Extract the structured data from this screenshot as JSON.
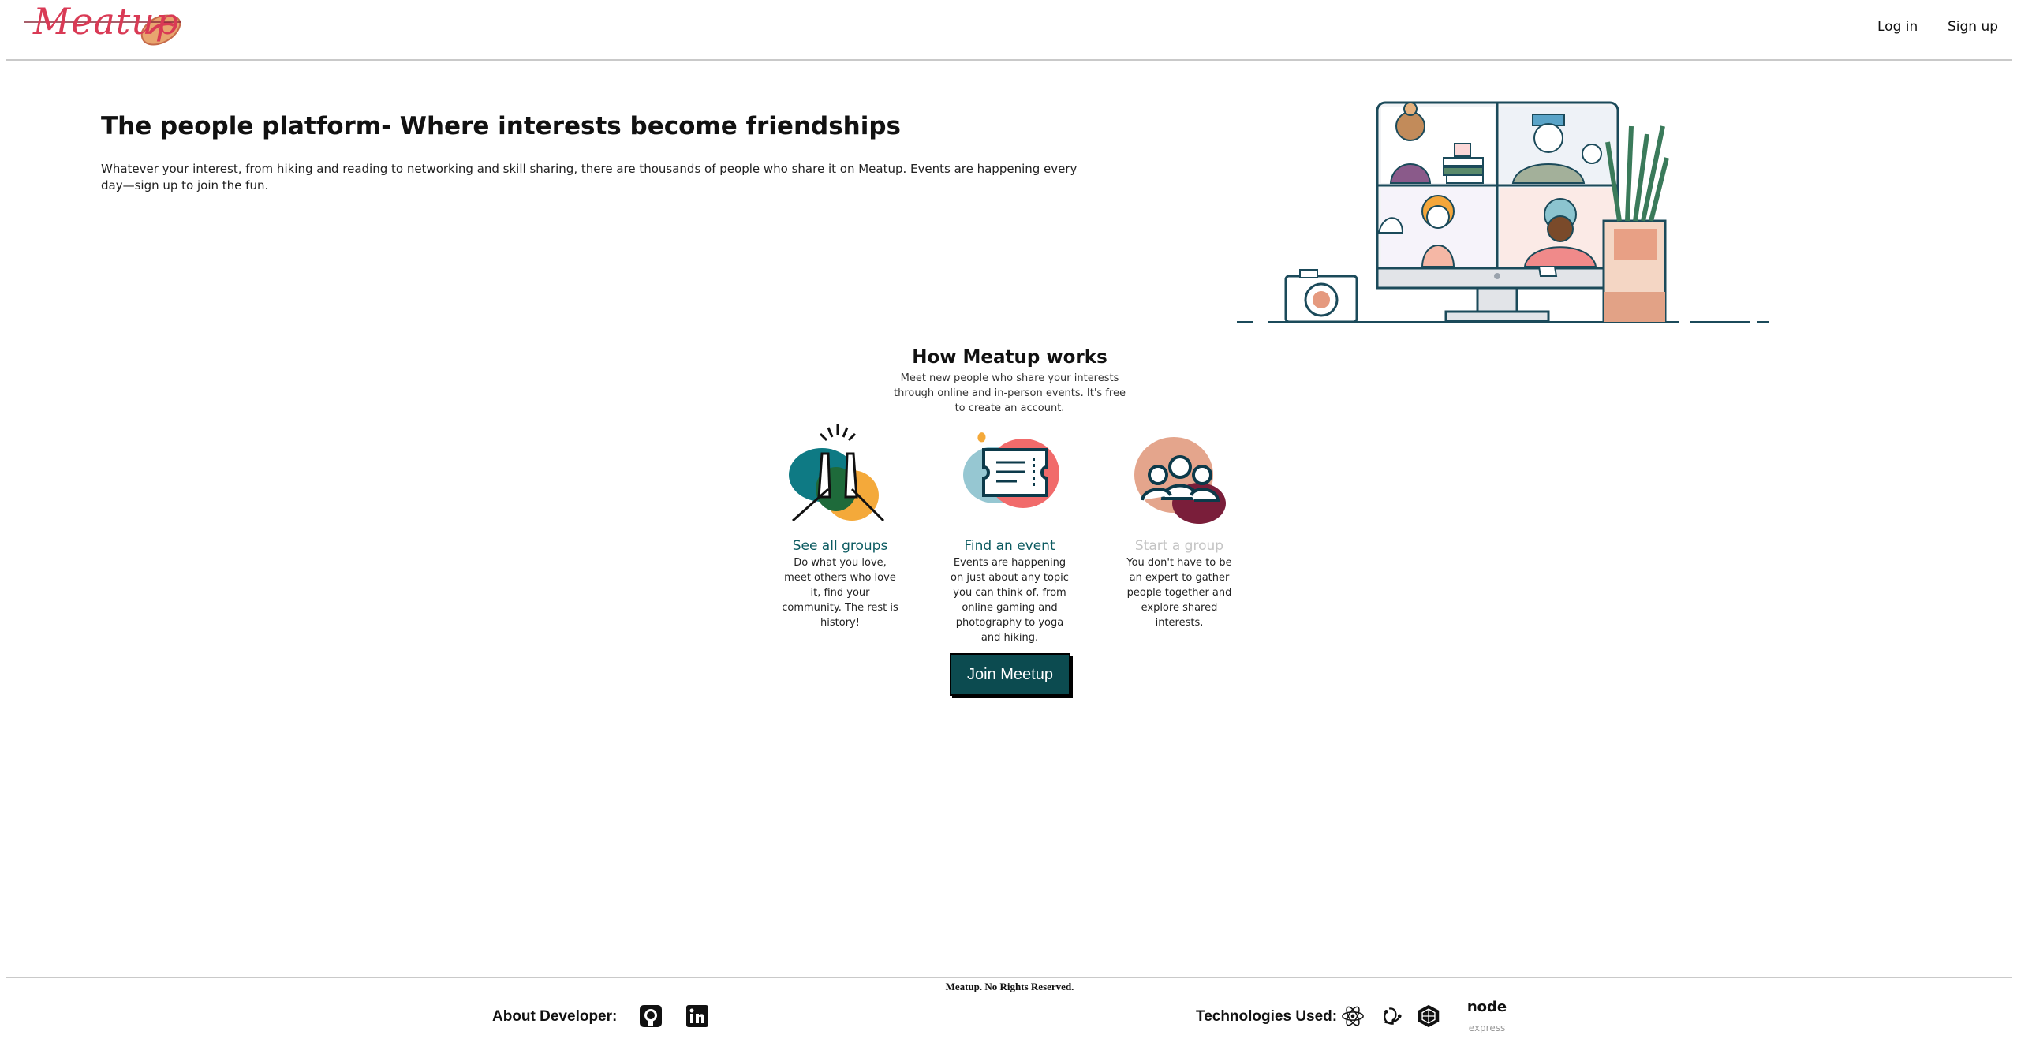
{
  "header": {
    "logo_text": "Meatup",
    "login_label": "Log in",
    "signup_label": "Sign up"
  },
  "hero": {
    "title": "The people platform- Where interests become friendships",
    "description": "Whatever your interest, from hiking and reading to networking and skill sharing, there are thousands of people who share it on Meatup. Events are happening every day—sign up to join the fun."
  },
  "how": {
    "title": "How Meatup works",
    "description": "Meet new people who share your interests through online and in-person events. It's free to create an account.",
    "cards": [
      {
        "title": "See all groups",
        "description": "Do what you love, meet others who love it, find your community. The rest is history!",
        "icon": "high-five-icon"
      },
      {
        "title": "Find an event",
        "description": "Events are happening on just about any topic you can think of, from online gaming and photography to yoga and hiking.",
        "icon": "ticket-icon"
      },
      {
        "title": "Start a group",
        "description": "You don't have to be an expert to gather people together and explore shared interests.",
        "icon": "people-group-icon"
      }
    ],
    "join_label": "Join Meetup"
  },
  "footer": {
    "copyright": "Meatup. No Rights Reserved.",
    "about_label": "About Developer:",
    "technologies_label": "Technologies Used:",
    "node_text": "node",
    "express_text": "express"
  },
  "colors": {
    "brand": "#d93a55",
    "teal": "#0c4b50",
    "card_title": "#0b5a60",
    "disabled": "#c4c4c4"
  }
}
